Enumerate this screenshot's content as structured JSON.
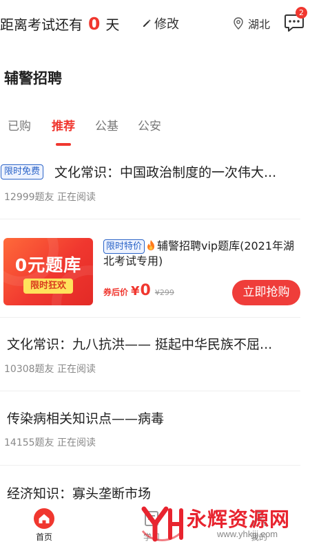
{
  "header": {
    "countdown_prefix": "距离考试还有",
    "countdown_days": "0",
    "countdown_suffix": "天",
    "edit_label": "修改",
    "region": "湖北",
    "message_count": "2"
  },
  "section_title": "辅警招聘",
  "tabs": [
    {
      "label": "已购",
      "active": false
    },
    {
      "label": "推荐",
      "active": true
    },
    {
      "label": "公基",
      "active": false
    },
    {
      "label": "公安",
      "active": false
    }
  ],
  "items": [
    {
      "tag": "限时免费",
      "title": "文化常识：中国政治制度的一次伟大...",
      "meta": "12999题友 正在阅读"
    },
    {
      "title": "文化常识：九八抗洪—— 挺起中华民族不屈...",
      "meta": "10308题友 正在阅读"
    },
    {
      "title": "传染病相关知识点——病毒",
      "meta": "14155题友 正在阅读"
    },
    {
      "title": "经济知识：寡头垄断市场"
    }
  ],
  "promo": {
    "thumb_title": "0元题库",
    "thumb_chip": "限时狂欢",
    "tag": "限时特价",
    "fire_icon": "fire-icon",
    "title": "辅警招聘vip题库(2021年湖北考试专用)",
    "price_label": "券后价",
    "currency": "¥",
    "price_now": "0",
    "price_old": "¥299",
    "button_label": "立即抢购"
  },
  "bottom_nav": [
    {
      "label": "首页",
      "icon": "home-icon",
      "active": true
    },
    {
      "label": "学习",
      "icon": "study-icon",
      "active": false
    },
    {
      "label": "我的",
      "icon": "profile-icon",
      "active": false
    }
  ],
  "watermark": {
    "text": "永辉资源网",
    "url": "www.yhkjjj.com"
  },
  "colors": {
    "accent": "#f0372f",
    "tag_blue": "#2a63c7",
    "button_red": "#ef3d3a"
  }
}
